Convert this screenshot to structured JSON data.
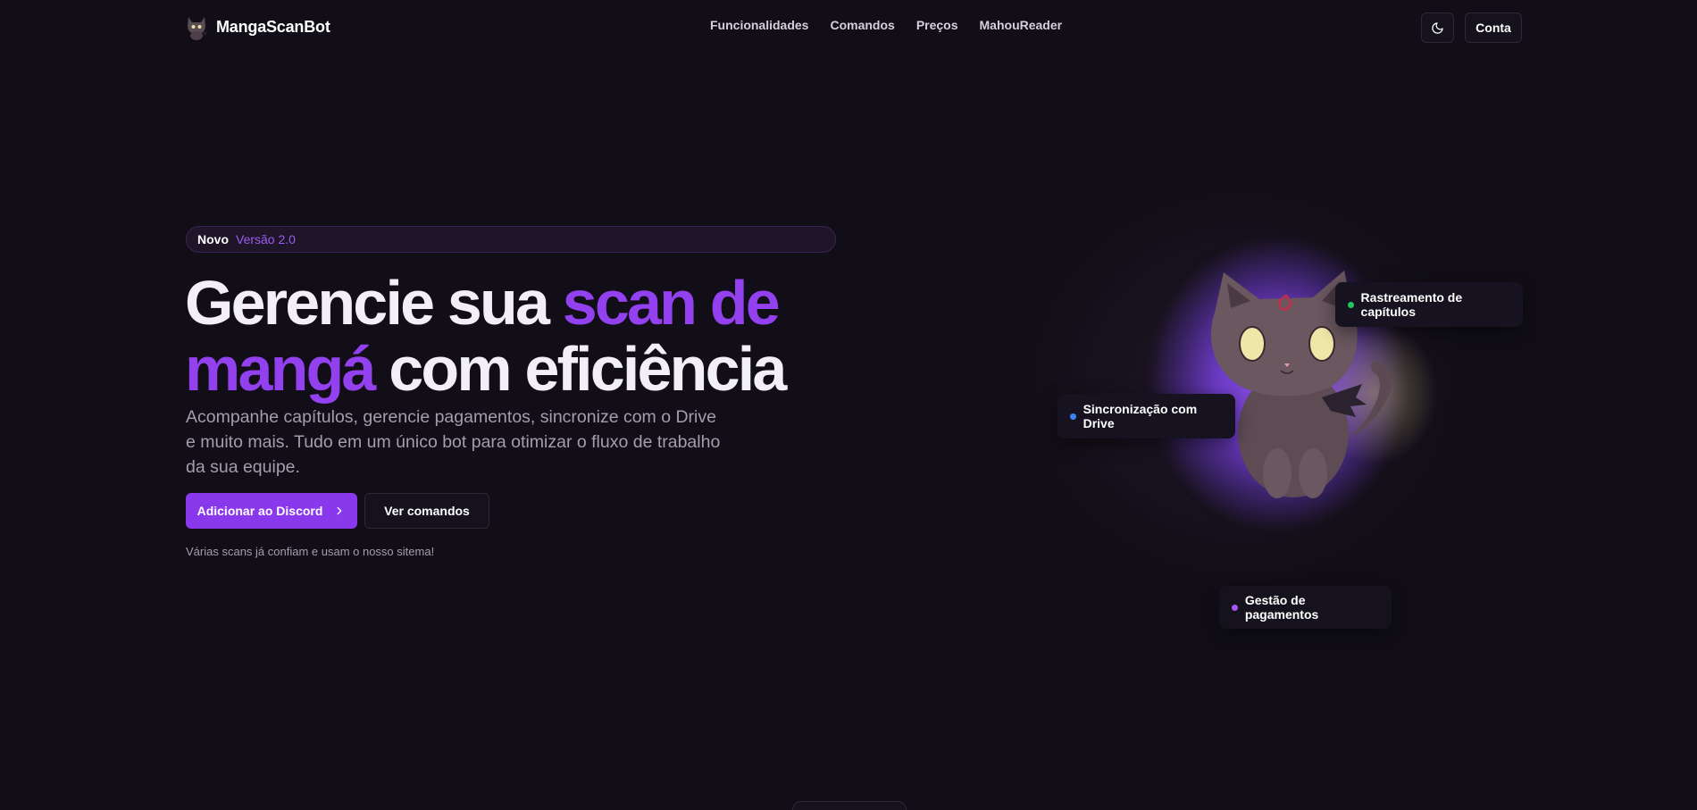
{
  "brand": {
    "name": "MangaScanBot",
    "icon": "cat-mascot-icon"
  },
  "nav": {
    "items": [
      {
        "label": "Funcionalidades"
      },
      {
        "label": "Comandos"
      },
      {
        "label": "Preços"
      },
      {
        "label": "MahouReader"
      }
    ]
  },
  "header": {
    "theme_icon": "moon-icon",
    "account_label": "Conta"
  },
  "hero": {
    "badge_new": "Novo",
    "badge_version": "Versão 2.0",
    "title_part1": "Gerencie sua ",
    "title_accent": "scan de mangá",
    "title_part2": " com eficiência",
    "subtitle": "Acompanhe capítulos, gerencie pagamentos, sincronize com o Drive e muito mais. Tudo em um único bot para otimizar o fluxo de trabalho da sua equipe.",
    "primary_cta": "Adicionar ao Discord",
    "secondary_cta": "Ver comandos",
    "trust_text": "Várias scans já confiam e usam o nosso sitema!"
  },
  "feature_cards": [
    {
      "label": "Rastreamento de capítulos",
      "dot_color": "#22c55e"
    },
    {
      "label": "Sincronização com Drive",
      "dot_color": "#3b82f6"
    },
    {
      "label": "Gestão de pagamentos",
      "dot_color": "#a855f7"
    }
  ],
  "colors": {
    "background": "#110e17",
    "accent": "#8a38ec",
    "title_accent": "#9340ee",
    "muted_text": "#a39eaf"
  }
}
